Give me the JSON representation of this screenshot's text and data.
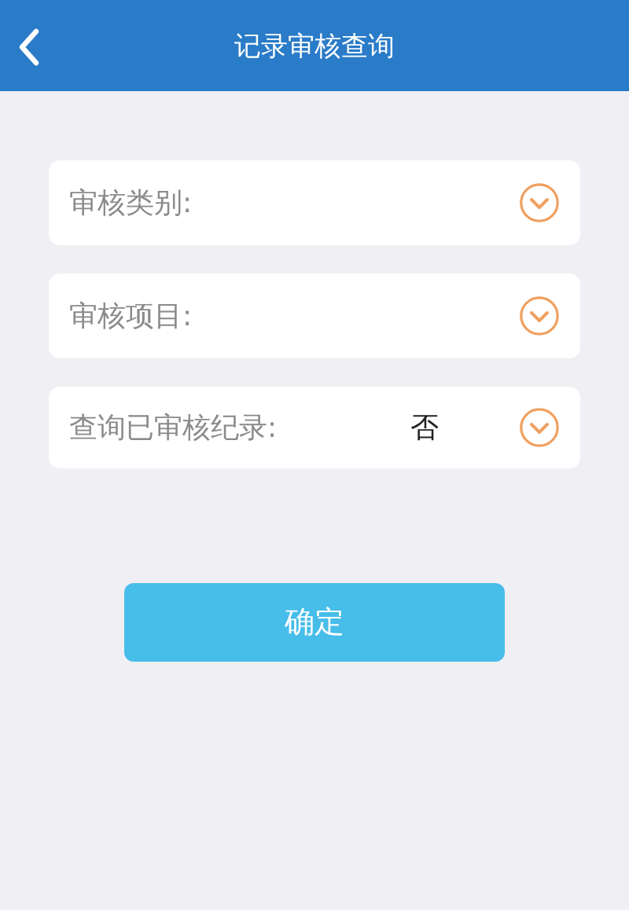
{
  "header": {
    "title": "记录审核查询"
  },
  "fields": [
    {
      "label": "审核类别:"
    },
    {
      "label": "审核项目:"
    },
    {
      "label": "查询已审核纪录:",
      "value": "否"
    }
  ],
  "buttons": [
    "确定"
  ]
}
